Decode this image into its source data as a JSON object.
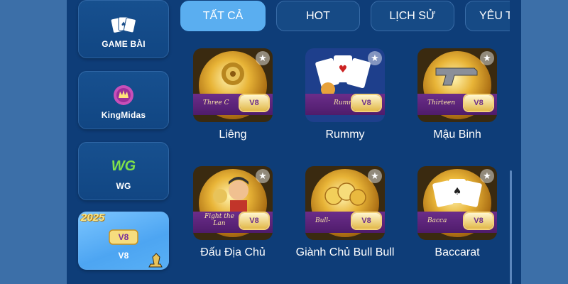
{
  "sidebar": {
    "items": [
      {
        "label": "GAME BÀI",
        "icon": "playing-cards-icon",
        "active": false
      },
      {
        "label": "KingMidas",
        "icon": "kingmidas-logo-icon",
        "active": false
      },
      {
        "label": "WG",
        "icon": "wg-logo-icon",
        "active": false
      },
      {
        "label": "V8",
        "icon": "v8-logo-icon",
        "active": true,
        "badge": "2025"
      }
    ]
  },
  "tabs": [
    {
      "label": "TẤT CẢ",
      "active": true
    },
    {
      "label": "HOT",
      "active": false
    },
    {
      "label": "LỊCH SỬ",
      "active": false
    },
    {
      "label": "YÊU THÍCH",
      "active": false
    }
  ],
  "games": [
    {
      "name": "Liêng",
      "banner": "Three C",
      "logo": "V8"
    },
    {
      "name": "Rummy",
      "banner": "Rumm",
      "logo": "V8"
    },
    {
      "name": "Mậu Binh",
      "banner": "Thirteen",
      "logo": "V8"
    },
    {
      "name": "Đấu Địa Chủ",
      "banner": "Fight the Lan",
      "logo": "V8"
    },
    {
      "name": "Giành Chủ Bull Bull",
      "banner": "Bull-",
      "logo": "V8"
    },
    {
      "name": "Baccarat",
      "banner": "Bacca",
      "logo": "V8"
    }
  ],
  "colors": {
    "background": "#3c6fa8",
    "panel": "#0e3d78",
    "tab_active": "#5aaef0",
    "tile_band": "#6b2d8a"
  }
}
